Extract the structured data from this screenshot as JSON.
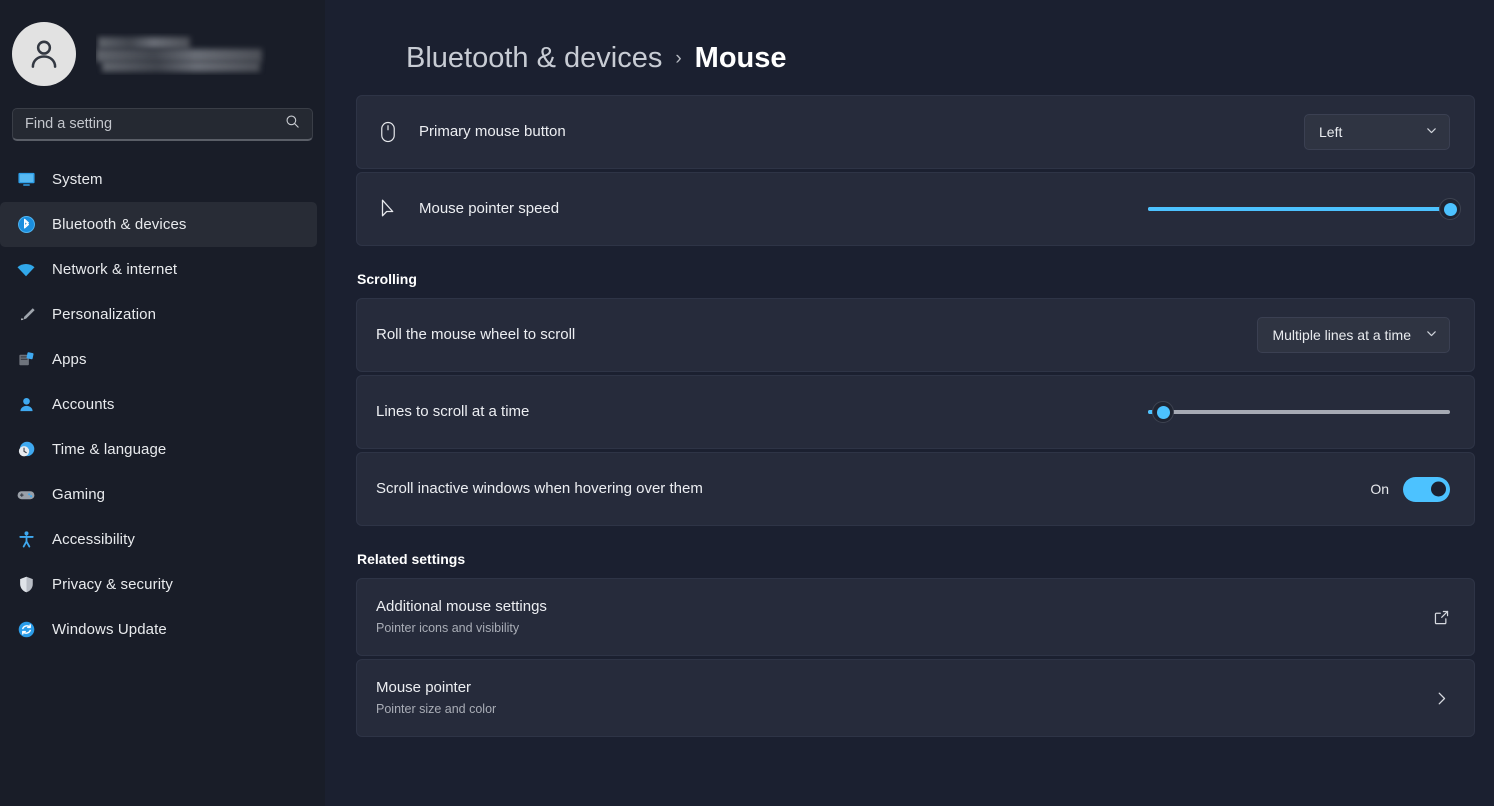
{
  "sidebar": {
    "account": {
      "name_redacted": true
    },
    "search": {
      "placeholder": "Find a setting",
      "value": ""
    },
    "items": [
      {
        "label": "System",
        "icon": "system-icon",
        "active": false
      },
      {
        "label": "Bluetooth & devices",
        "icon": "bluetooth-icon",
        "active": true
      },
      {
        "label": "Network & internet",
        "icon": "wifi-icon",
        "active": false
      },
      {
        "label": "Personalization",
        "icon": "brush-icon",
        "active": false
      },
      {
        "label": "Apps",
        "icon": "apps-icon",
        "active": false
      },
      {
        "label": "Accounts",
        "icon": "account-icon",
        "active": false
      },
      {
        "label": "Time & language",
        "icon": "clock-icon",
        "active": false
      },
      {
        "label": "Gaming",
        "icon": "gamepad-icon",
        "active": false
      },
      {
        "label": "Accessibility",
        "icon": "accessibility-icon",
        "active": false
      },
      {
        "label": "Privacy & security",
        "icon": "shield-icon",
        "active": false
      },
      {
        "label": "Windows Update",
        "icon": "update-icon",
        "active": false
      }
    ]
  },
  "breadcrumb": {
    "parent": "Bluetooth & devices",
    "separator": "›",
    "current": "Mouse"
  },
  "settings": {
    "primary_mouse_button": {
      "label": "Primary mouse button",
      "icon": "mouse-icon",
      "value": "Left"
    },
    "mouse_pointer_speed": {
      "label": "Mouse pointer speed",
      "icon": "cursor-icon",
      "value_percent": 100
    }
  },
  "scrolling": {
    "heading": "Scrolling",
    "roll_wheel": {
      "label": "Roll the mouse wheel to scroll",
      "value": "Multiple lines at a time"
    },
    "lines_to_scroll": {
      "label": "Lines to scroll at a time",
      "value_percent": 5
    },
    "scroll_inactive": {
      "label": "Scroll inactive windows when hovering over them",
      "state_label": "On",
      "state": true
    }
  },
  "related_settings": {
    "heading": "Related settings",
    "items": [
      {
        "title": "Additional mouse settings",
        "subtitle": "Pointer icons and visibility",
        "trailing_icon": "external-link-icon"
      },
      {
        "title": "Mouse pointer",
        "subtitle": "Pointer size and color",
        "trailing_icon": "chevron-right-icon"
      }
    ]
  },
  "colors": {
    "accent": "#4cc2ff",
    "page_bg": "#1b2030",
    "sidebar_bg": "#191d28",
    "card_bg": "#262b3b"
  }
}
